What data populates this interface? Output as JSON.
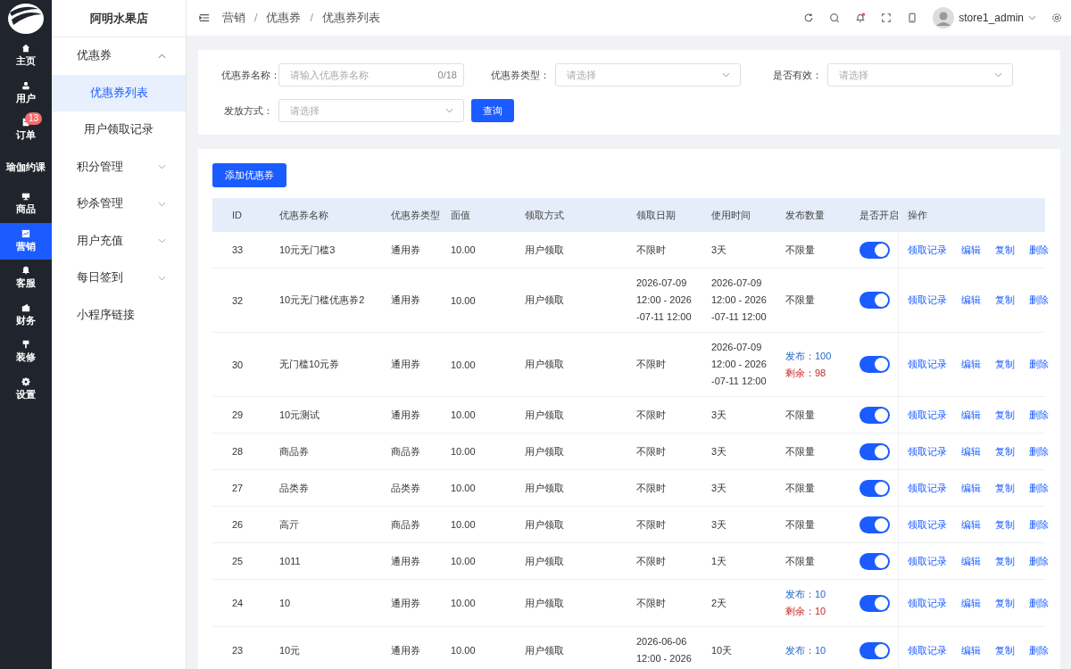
{
  "rail": [
    {
      "label": "主页",
      "selected": false
    },
    {
      "label": "用户",
      "selected": false
    },
    {
      "label": "订单",
      "selected": false,
      "badge": "13"
    },
    {
      "label": "瑜伽约课",
      "selected": false
    },
    {
      "label": "商品",
      "selected": false
    },
    {
      "label": "营销",
      "selected": true
    },
    {
      "label": "客服",
      "selected": false
    },
    {
      "label": "财务",
      "selected": false
    },
    {
      "label": "装修",
      "selected": false
    },
    {
      "label": "设置",
      "selected": false
    }
  ],
  "shop_name": "阿明水果店",
  "sidebar": {
    "items": [
      {
        "kind": "group",
        "label": "优惠券",
        "expanded": true,
        "children": [
          {
            "label": "优惠券列表",
            "selected": true
          },
          {
            "label": "用户领取记录",
            "selected": false
          }
        ]
      },
      {
        "kind": "group",
        "label": "积分管理",
        "expanded": false
      },
      {
        "kind": "group",
        "label": "秒杀管理",
        "expanded": false
      },
      {
        "kind": "group",
        "label": "用户充值",
        "expanded": false
      },
      {
        "kind": "group",
        "label": "每日签到",
        "expanded": false
      },
      {
        "kind": "link",
        "label": "小程序链接"
      }
    ]
  },
  "breadcrumb": [
    {
      "label": "营销"
    },
    {
      "separator": "/",
      "label": "优惠券"
    },
    {
      "separator": "/",
      "label": "优惠券列表"
    }
  ],
  "user": {
    "name": "store1_admin",
    "notification_dot": true
  },
  "filters": [
    {
      "label": "优惠券名称：",
      "kind": "input",
      "placeholder": "请输入优惠券名称",
      "counter": "0/18"
    },
    {
      "label": "优惠券类型：",
      "kind": "select",
      "placeholder": "请选择"
    },
    {
      "label": "是否有效：",
      "kind": "select",
      "placeholder": "请选择"
    },
    {
      "label": "发放方式：",
      "kind": "select",
      "placeholder": "请选择"
    }
  ],
  "search_button": "查询",
  "add_button": "添加优惠券",
  "table": {
    "columns": [
      "ID",
      "优惠券名称",
      "优惠券类型",
      "面值",
      "领取方式",
      "领取日期",
      "使用时间",
      "发布数量",
      "是否开启",
      "操作"
    ],
    "rows": [
      {
        "id": "33",
        "name": "10元无门槛3",
        "type": "通用券",
        "value": "10.00",
        "method": "用户领取",
        "date": [
          "不限时"
        ],
        "use": [
          "3天"
        ],
        "qty": {
          "kind": "unlimited",
          "text": "不限量"
        },
        "on": true,
        "actions": [
          "领取记录",
          "编辑",
          "复制",
          "删除"
        ]
      },
      {
        "id": "32",
        "name": "10元无门槛优惠券2",
        "type": "通用券",
        "value": "10.00",
        "method": "用户领取",
        "date": [
          "2026-07-09",
          "12:00 - 2026",
          "-07-11 12:00"
        ],
        "use": [
          "2026-07-09",
          "12:00 - 2026",
          "-07-11 12:00"
        ],
        "qty": {
          "kind": "unlimited",
          "text": "不限量"
        },
        "on": true,
        "actions": [
          "领取记录",
          "编辑",
          "复制",
          "删除"
        ]
      },
      {
        "id": "30",
        "name": "无门槛10元券",
        "type": "通用券",
        "value": "10.00",
        "method": "用户领取",
        "date": [
          "不限时"
        ],
        "use": [
          "2026-07-09",
          "12:00 - 2026",
          "-07-11 12:00"
        ],
        "qty": {
          "kind": "limited",
          "issued": "发布：100",
          "remaining": "剩余：98"
        },
        "on": true,
        "actions": [
          "领取记录",
          "编辑",
          "复制",
          "删除"
        ]
      },
      {
        "id": "29",
        "name": "10元测试",
        "type": "通用券",
        "value": "10.00",
        "method": "用户领取",
        "date": [
          "不限时"
        ],
        "use": [
          "3天"
        ],
        "qty": {
          "kind": "unlimited",
          "text": "不限量"
        },
        "on": true,
        "actions": [
          "领取记录",
          "编辑",
          "复制",
          "删除"
        ]
      },
      {
        "id": "28",
        "name": "商品券",
        "type": "商品券",
        "value": "10.00",
        "method": "用户领取",
        "date": [
          "不限时"
        ],
        "use": [
          "3天"
        ],
        "qty": {
          "kind": "unlimited",
          "text": "不限量"
        },
        "on": true,
        "actions": [
          "领取记录",
          "编辑",
          "复制",
          "删除"
        ]
      },
      {
        "id": "27",
        "name": "品类券",
        "type": "品类券",
        "value": "10.00",
        "method": "用户领取",
        "date": [
          "不限时"
        ],
        "use": [
          "3天"
        ],
        "qty": {
          "kind": "unlimited",
          "text": "不限量"
        },
        "on": true,
        "actions": [
          "领取记录",
          "编辑",
          "复制",
          "删除"
        ]
      },
      {
        "id": "26",
        "name": "高亓",
        "type": "商品券",
        "value": "10.00",
        "method": "用户领取",
        "date": [
          "不限时"
        ],
        "use": [
          "3天"
        ],
        "qty": {
          "kind": "unlimited",
          "text": "不限量"
        },
        "on": true,
        "actions": [
          "领取记录",
          "编辑",
          "复制",
          "删除"
        ]
      },
      {
        "id": "25",
        "name": "1011",
        "type": "通用券",
        "value": "10.00",
        "method": "用户领取",
        "date": [
          "不限时"
        ],
        "use": [
          "1天"
        ],
        "qty": {
          "kind": "unlimited",
          "text": "不限量"
        },
        "on": true,
        "actions": [
          "领取记录",
          "编辑",
          "复制",
          "删除"
        ]
      },
      {
        "id": "24",
        "name": "10",
        "type": "通用券",
        "value": "10.00",
        "method": "用户领取",
        "date": [
          "不限时"
        ],
        "use": [
          "2天"
        ],
        "qty": {
          "kind": "limited",
          "issued": "发布：10",
          "remaining": "剩余：10"
        },
        "on": true,
        "actions": [
          "领取记录",
          "编辑",
          "复制",
          "删除"
        ]
      },
      {
        "id": "23",
        "name": "10元",
        "type": "通用券",
        "value": "10.00",
        "method": "用户领取",
        "date": [
          "2026-06-06",
          "12:00 - 2026"
        ],
        "use": [
          "10天"
        ],
        "qty": {
          "kind": "limited",
          "issued": "发布：10"
        },
        "on": true,
        "actions": [
          "领取记录",
          "编辑",
          "复制",
          "删除"
        ]
      }
    ]
  }
}
